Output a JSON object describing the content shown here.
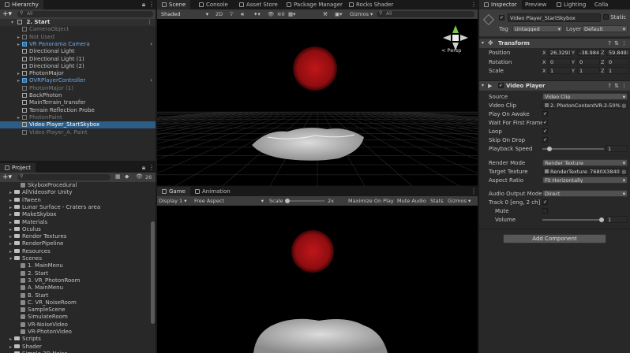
{
  "hierarchy": {
    "tab": "Hierarchy",
    "search_placeholder": "All",
    "scene": "2. Start",
    "items": [
      {
        "label": "CameraObject",
        "style": "dim",
        "fold": ""
      },
      {
        "label": "Not Used",
        "style": "dim",
        "fold": "▸"
      },
      {
        "label": "VR Panorama Camera",
        "style": "blue",
        "fold": "▸"
      },
      {
        "label": "Directional Light",
        "style": "",
        "fold": ""
      },
      {
        "label": "Directional Light (1)",
        "style": "",
        "fold": ""
      },
      {
        "label": "Directional Light (2)",
        "style": "",
        "fold": ""
      },
      {
        "label": "PhotonMajor",
        "style": "",
        "fold": "▸"
      },
      {
        "label": "OVRPlayerController",
        "style": "blue",
        "fold": "▸"
      },
      {
        "label": "PhotonMajor (1)",
        "style": "dim",
        "fold": ""
      },
      {
        "label": "BackPhoton",
        "style": "",
        "fold": ""
      },
      {
        "label": "MainTerrain_transfer",
        "style": "",
        "fold": ""
      },
      {
        "label": "Terrain Reflection Probe",
        "style": "",
        "fold": ""
      },
      {
        "label": "PhotonPaint",
        "style": "dim",
        "fold": "▸"
      },
      {
        "label": "Video Player_StartSkybox",
        "style": "sel",
        "fold": ""
      },
      {
        "label": "Video Player_A. Paint",
        "style": "dim",
        "fold": ""
      }
    ]
  },
  "project": {
    "tab": "Project",
    "count_badge": "26",
    "items": [
      {
        "label": "SkyboxProcedural",
        "indent": 2,
        "type": "scene",
        "fold": ""
      },
      {
        "label": "AllVideosFor Unity",
        "indent": 1,
        "type": "folder",
        "fold": "▸"
      },
      {
        "label": "iTween",
        "indent": 1,
        "type": "folder",
        "fold": "▸"
      },
      {
        "label": "Lunar Surface - Craters area",
        "indent": 1,
        "type": "folder",
        "fold": "▸"
      },
      {
        "label": "MakeSkybox",
        "indent": 1,
        "type": "folder",
        "fold": "▸"
      },
      {
        "label": "Materials",
        "indent": 1,
        "type": "folder",
        "fold": "▸"
      },
      {
        "label": "Oculus",
        "indent": 1,
        "type": "folder",
        "fold": "▸"
      },
      {
        "label": "Render Textures",
        "indent": 1,
        "type": "folder",
        "fold": "▸"
      },
      {
        "label": "RenderPipeline",
        "indent": 1,
        "type": "folder",
        "fold": "▸"
      },
      {
        "label": "Resources",
        "indent": 1,
        "type": "folder",
        "fold": "▸"
      },
      {
        "label": "Scenes",
        "indent": 1,
        "type": "folder",
        "fold": "▾"
      },
      {
        "label": "1. MainMenu",
        "indent": 2,
        "type": "scene",
        "fold": ""
      },
      {
        "label": "2. Start",
        "indent": 2,
        "type": "scene",
        "fold": ""
      },
      {
        "label": "3. VR_PhotonRoom",
        "indent": 2,
        "type": "scene",
        "fold": ""
      },
      {
        "label": "A. MainMenu",
        "indent": 2,
        "type": "scene",
        "fold": ""
      },
      {
        "label": "B. Start",
        "indent": 2,
        "type": "scene",
        "fold": ""
      },
      {
        "label": "C. VR_NoiseRoom",
        "indent": 2,
        "type": "scene",
        "fold": ""
      },
      {
        "label": "SampleScene",
        "indent": 2,
        "type": "scene",
        "fold": ""
      },
      {
        "label": "SimulateRoom",
        "indent": 2,
        "type": "scene",
        "fold": ""
      },
      {
        "label": "VR-NoiseVideo",
        "indent": 2,
        "type": "scene",
        "fold": ""
      },
      {
        "label": "VR-PhotonVideo",
        "indent": 2,
        "type": "scene",
        "fold": ""
      },
      {
        "label": "Scripts",
        "indent": 1,
        "type": "folder",
        "fold": "▸"
      },
      {
        "label": "Shader",
        "indent": 1,
        "type": "folder",
        "fold": "▸"
      },
      {
        "label": "Simple 3D Noise",
        "indent": 1,
        "type": "folder",
        "fold": "▸"
      }
    ]
  },
  "scene_tabs": {
    "scene": "Scene",
    "console": "Console",
    "asset_store": "Asset Store",
    "package_manager": "Package Manager",
    "rocks_shader": "Rocks Shader"
  },
  "scene_toolbar": {
    "shading": "Shaded",
    "mode": "2D",
    "gizmos": "Gizmos",
    "search": "All",
    "layers_count": "0"
  },
  "gizmo": {
    "persp": "< Persp"
  },
  "game_tabs": {
    "game": "Game",
    "animation": "Animation"
  },
  "game_toolbar": {
    "display": "Display 1",
    "aspect": "Free Aspect",
    "scale_label": "Scale",
    "scale_value": "2x",
    "maximize": "Maximize On Play",
    "mute": "Mute Audio",
    "stats": "Stats",
    "gizmos": "Gizmos"
  },
  "inspector_tabs": {
    "inspector": "Inspector",
    "preview": "Preview",
    "lighting": "Lighting",
    "collab": "Colla"
  },
  "object": {
    "name": "Video Player_StartSkybox",
    "static": "Static",
    "tag_label": "Tag",
    "tag": "Untagged",
    "layer_label": "Layer",
    "layer": "Default"
  },
  "transform": {
    "title": "Transform",
    "position_label": "Position",
    "rotation_label": "Rotation",
    "scale_label": "Scale",
    "pos": {
      "x": "26.3291",
      "y": "-38.984",
      "z": "59.8493"
    },
    "rot": {
      "x": "0",
      "y": "0",
      "z": "0"
    },
    "scl": {
      "x": "1",
      "y": "1",
      "z": "1"
    }
  },
  "video_player": {
    "title": "Video Player",
    "source_label": "Source",
    "source": "Video Clip",
    "clip_label": "Video Clip",
    "clip": "2. PhotonContentVR-2-50%",
    "play_on_awake_label": "Play On Awake",
    "wait_label": "Wait For First Frame",
    "loop_label": "Loop",
    "skip_label": "Skip On Drop",
    "speed_label": "Playback Speed",
    "speed": "1",
    "render_mode_label": "Render Mode",
    "render_mode": "Render Texture",
    "target_label": "Target Texture",
    "target": "RenderTexture_7680X3840",
    "aspect_label": "Aspect Ratio",
    "aspect": "Fit Horizontally",
    "audio_mode_label": "Audio Output Mode",
    "audio_mode": "Direct",
    "track_label": "Track 0 [eng, 2 ch]",
    "mute_label": "Mute",
    "volume_label": "Volume",
    "volume": "1"
  },
  "add_component": "Add Component",
  "check": "✓"
}
